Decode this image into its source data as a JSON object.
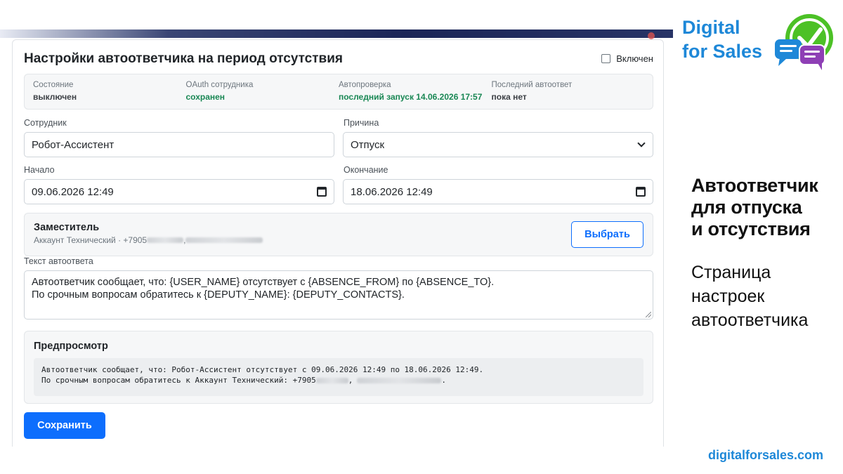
{
  "window": {
    "title": "Настройки автоответчика на период отсутствия",
    "enabled_label": "Включен"
  },
  "status": [
    {
      "label": "Состояние",
      "value": "выключен"
    },
    {
      "label": "OAuth сотрудника",
      "value": "сохранен"
    },
    {
      "label": "Автопроверка",
      "value": "последний запуск 14.06.2026 17:57"
    },
    {
      "label": "Последний автоответ",
      "value": "пока нет"
    }
  ],
  "form": {
    "employee_label": "Сотрудник",
    "employee_value": "Робот-Ассистент",
    "reason_label": "Причина",
    "reason_value": "Отпуск",
    "start_label": "Начало",
    "start_value": "09.06.2026 12:49",
    "end_label": "Окончание",
    "end_value": "18.06.2026 12:49"
  },
  "deputy": {
    "title": "Заместитель",
    "subtitle_prefix": "Аккаунт Технический · +7905",
    "subtitle_separator": ",",
    "select_label": "Выбрать"
  },
  "reply": {
    "label": "Текст автоответа",
    "line1": "Автоответчик сообщает, что: {USER_NAME} отсутствует с {ABSENCE_FROM} по {ABSENCE_TO}.",
    "line2": "По срочным вопросам обратитесь к {DEPUTY_NAME}: {DEPUTY_CONTACTS}."
  },
  "preview": {
    "title": "Предпросмотр",
    "line1": "Автоответчик сообщает, что: Робот-Ассистент отсутствует с 09.06.2026 12:49 по 18.06.2026 12:49.",
    "line2_prefix": "По срочным вопросам обратитесь к Аккаунт Технический: +7905",
    "line2_separator": ",",
    "line2_end": "."
  },
  "save_label": "Сохранить",
  "branding": {
    "brand_line1": "Digital",
    "brand_line2": "for Sales",
    "headline_line1": "Автоответчик",
    "headline_line2": "для отпуска",
    "headline_line3": "и отсутствия",
    "sub_line1": "Страница",
    "sub_line2": "настроек",
    "sub_line3": "автоответчика",
    "site": "digitalforsales.com",
    "accent_color": "#1e88d8",
    "logo_green": "#4cc126",
    "logo_purple": "#8e3fb5"
  }
}
